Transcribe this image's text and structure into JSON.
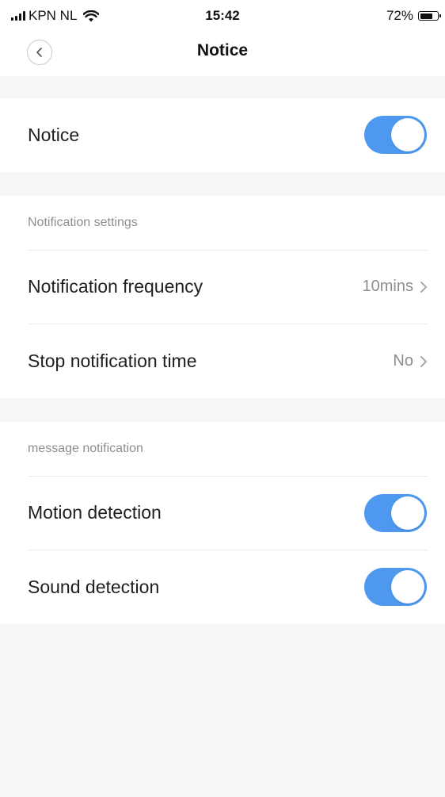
{
  "status_bar": {
    "carrier": "KPN NL",
    "time": "15:42",
    "battery_percent": "72%",
    "battery_level": 0.72
  },
  "nav": {
    "title": "Notice",
    "back_icon": "chevron-left-icon"
  },
  "notice": {
    "label": "Notice",
    "enabled": true
  },
  "notification_settings": {
    "header": "Notification settings",
    "items": [
      {
        "label": "Notification frequency",
        "value": "10mins"
      },
      {
        "label": "Stop notification time",
        "value": "No"
      }
    ]
  },
  "message_notification": {
    "header": "message notification",
    "items": [
      {
        "label": "Motion detection",
        "enabled": true
      },
      {
        "label": "Sound detection",
        "enabled": true
      }
    ]
  },
  "colors": {
    "accent": "#4e98f0",
    "background": "#f5f6f6",
    "card": "#ffffff"
  }
}
